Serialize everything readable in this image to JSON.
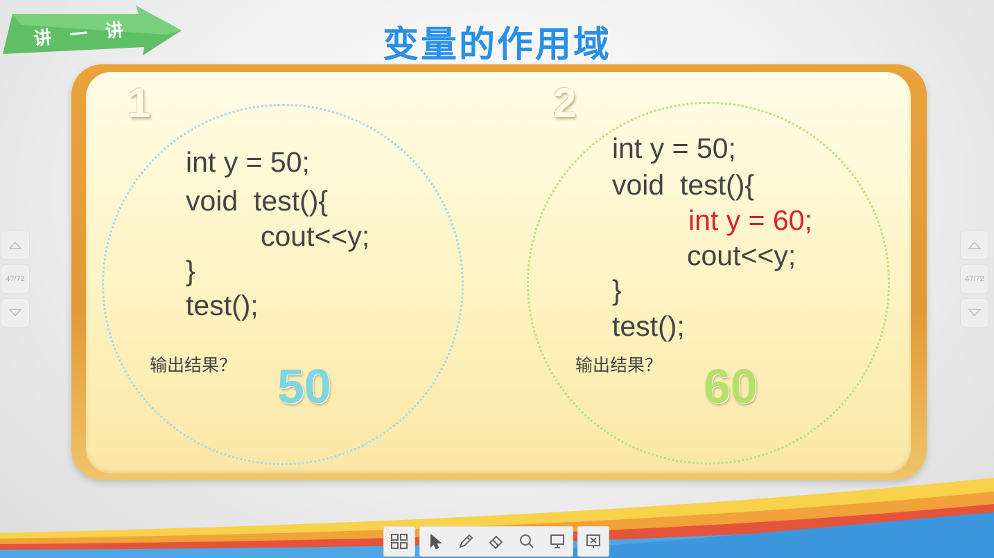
{
  "badge": {
    "label": "讲一讲"
  },
  "slide": {
    "title": "变量的作用域"
  },
  "example1": {
    "number": "1",
    "code": [
      "int y = 50;",
      "void  test(){",
      "cout<<y;",
      "}",
      "test();"
    ],
    "question": "输出结果？",
    "answer": "50",
    "answer_color": "#7fd6e0"
  },
  "example2": {
    "number": "2",
    "code": [
      "int y = 50;",
      "void  test(){",
      "int y = 60;",
      "cout<<y;",
      "}",
      "test();"
    ],
    "question": "输出结果？",
    "answer": "60",
    "answer_color": "#b6e06a",
    "highlight_color": "#d9202a"
  },
  "nav": {
    "page_counter": "47/72",
    "up_icon": "triangle-up-icon",
    "down_icon": "triangle-down-icon"
  },
  "toolbar": {
    "icons": [
      "grid-menu-icon",
      "pointer-icon",
      "pen-icon",
      "eraser-icon",
      "search-icon",
      "presentation-icon",
      "exit-presentation-icon"
    ]
  },
  "colors": {
    "title": "#2a8fe6",
    "frame": "#e29a36",
    "panel": "#fdf3c2",
    "badge": "#63c26a"
  }
}
